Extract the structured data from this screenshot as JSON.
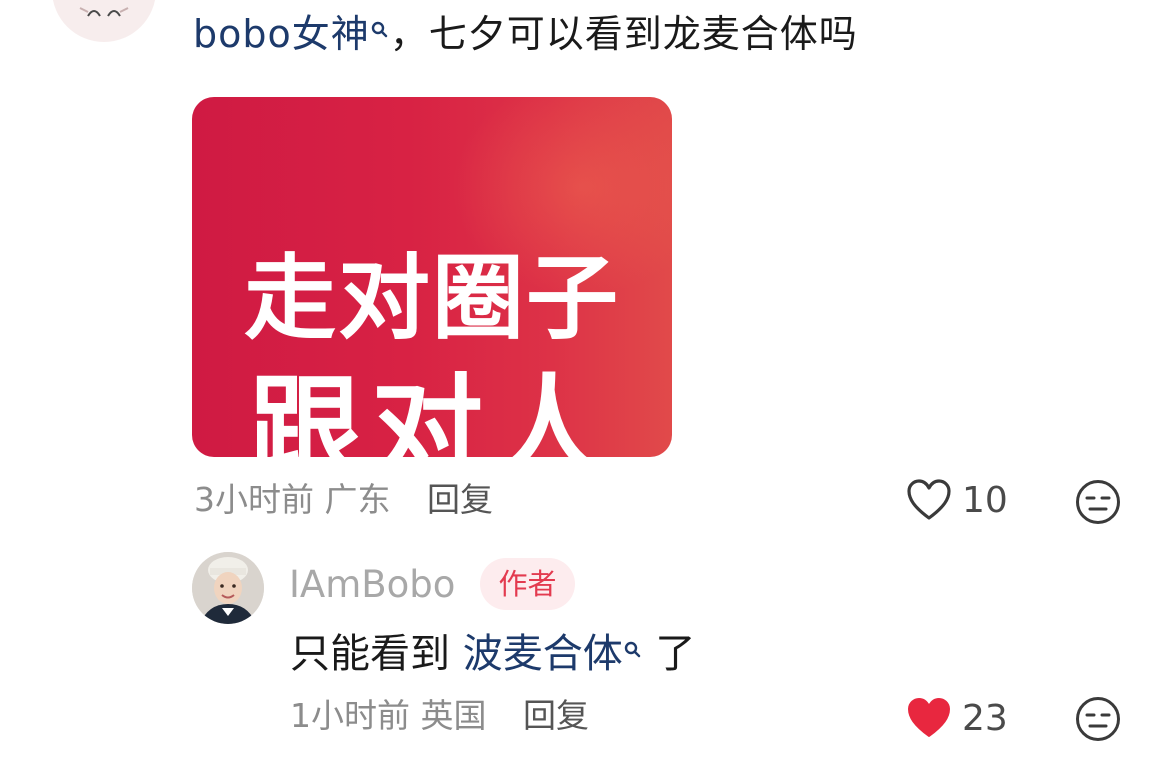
{
  "comment": {
    "mention": "bobo女神",
    "text": "，七夕可以看到龙麦合体吗",
    "sticker": {
      "line1": "走对圈子",
      "line2": "跟对人"
    },
    "time_location": "3小时前 广东",
    "reply_label": "回复",
    "like_count": "10",
    "liked": false
  },
  "reply": {
    "username": "IAmBobo",
    "badge": "作者",
    "text_before": "只能看到 ",
    "mention": "波麦合体",
    "text_after": " 了",
    "time_location": "1小时前 英国",
    "reply_label": "回复",
    "like_count": "23",
    "liked": true
  },
  "colors": {
    "mention": "#1d3a6b",
    "like_active": "#e8273f",
    "sticker_bg": "#d82244"
  }
}
